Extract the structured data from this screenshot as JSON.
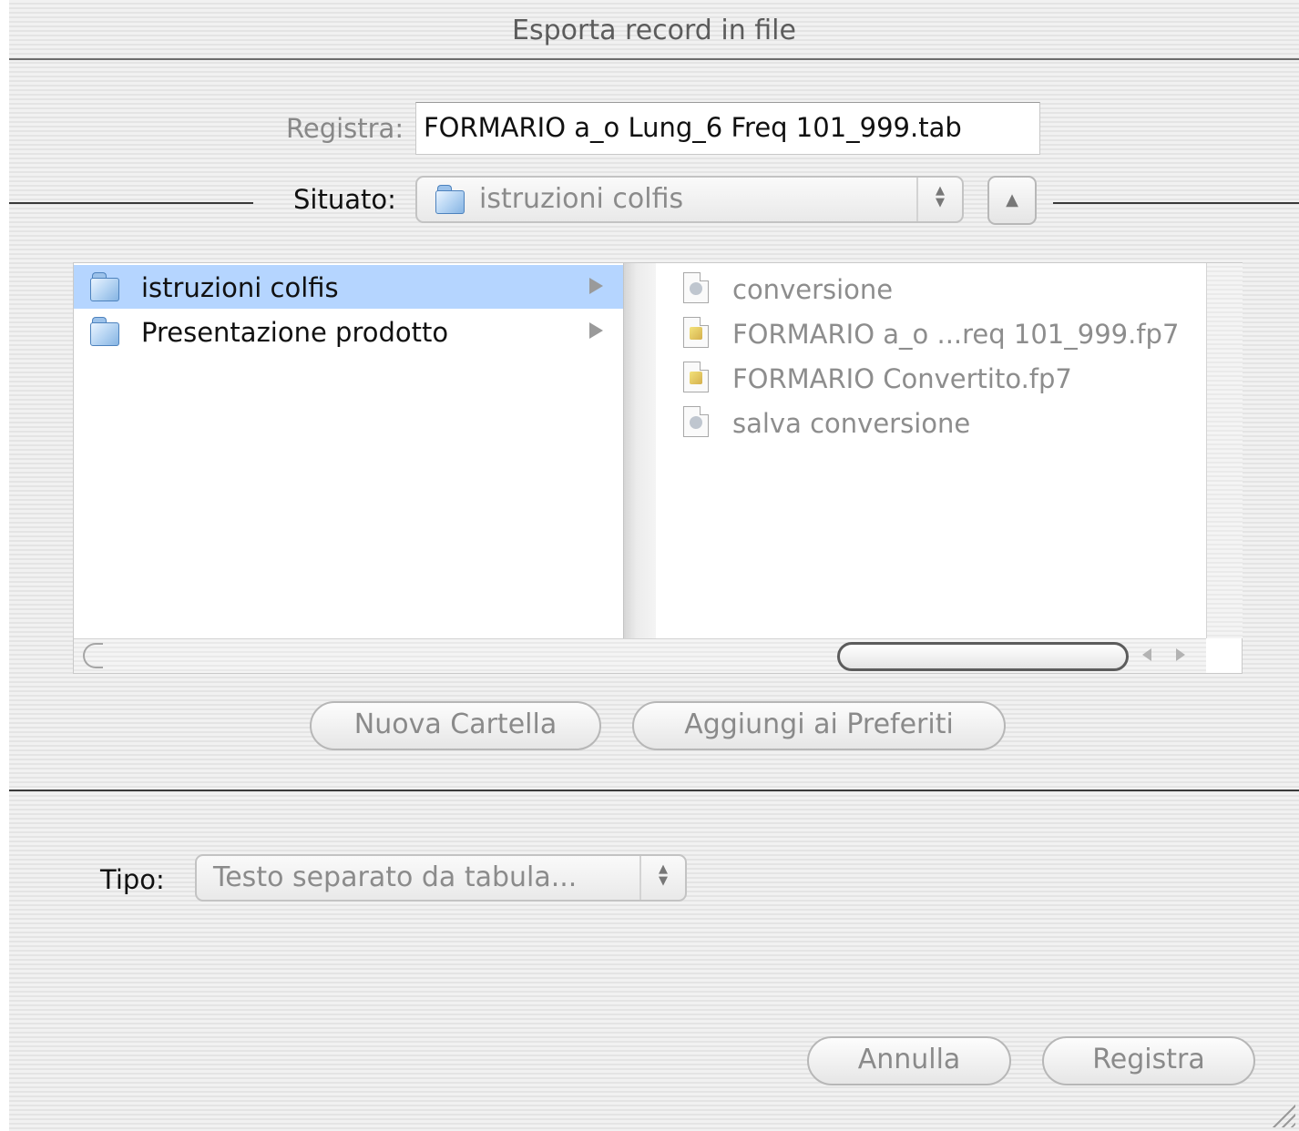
{
  "window": {
    "title": "Esporta record in file"
  },
  "save": {
    "label": "Registra:",
    "filename": "FORMARIO a_o Lung_6 Freq 101_999.tab"
  },
  "location": {
    "label": "Situato:",
    "value": "istruzioni colfis",
    "up_icon": "triangle-up-icon"
  },
  "browser": {
    "folders": [
      {
        "name": "istruzioni colfis",
        "selected": true
      },
      {
        "name": "Presentazione prodotto",
        "selected": false
      }
    ],
    "files": [
      {
        "name": "conversione",
        "icon": "script-document-icon"
      },
      {
        "name": "FORMARIO a_o ...req 101_999.fp7",
        "icon": "database-document-icon"
      },
      {
        "name": "FORMARIO Convertito.fp7",
        "icon": "database-document-icon"
      },
      {
        "name": "salva conversione",
        "icon": "script-document-icon"
      }
    ]
  },
  "buttons": {
    "new_folder": "Nuova Cartella",
    "add_favorites": "Aggiungi ai Preferiti",
    "cancel": "Annulla",
    "save": "Registra"
  },
  "format": {
    "label": "Tipo:",
    "value": "Testo separato da tabula..."
  },
  "colors": {
    "selection": "#b5d5ff",
    "rule": "#3a3a3a"
  }
}
